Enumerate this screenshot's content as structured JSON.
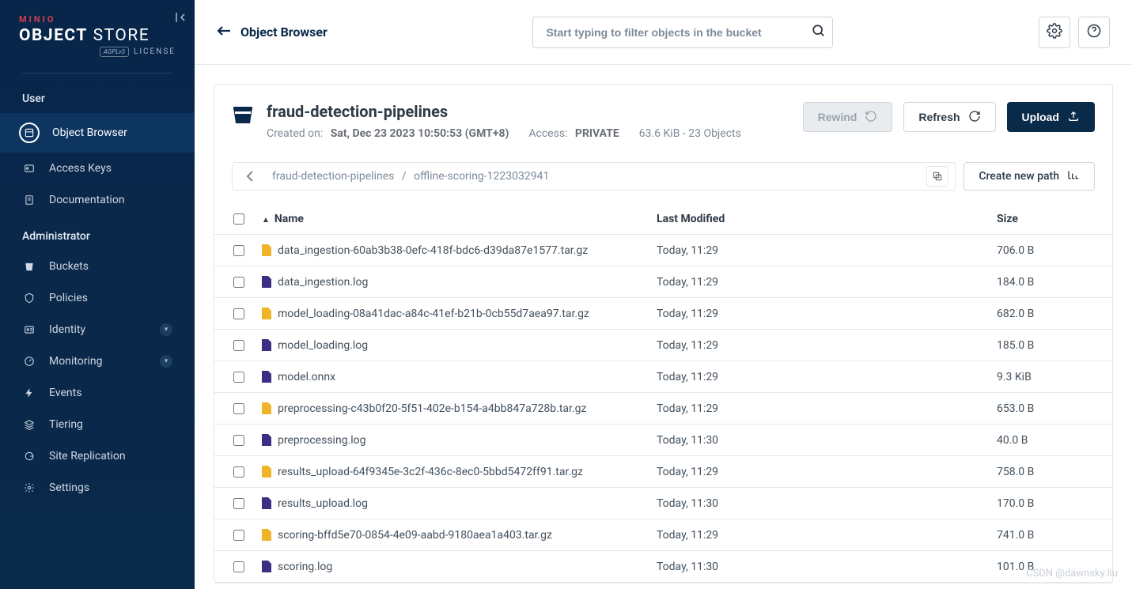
{
  "brand": {
    "minio": "MINIO",
    "object": "OBJECT",
    "store": "STORE",
    "license": "LICENSE",
    "agpl": "AGPLv3"
  },
  "sidebar": {
    "sections": [
      {
        "title": "User",
        "items": [
          {
            "label": "Object Browser",
            "icon": "layers"
          },
          {
            "label": "Access Keys",
            "icon": "key"
          },
          {
            "label": "Documentation",
            "icon": "doc"
          }
        ]
      },
      {
        "title": "Administrator",
        "items": [
          {
            "label": "Buckets",
            "icon": "bucket"
          },
          {
            "label": "Policies",
            "icon": "shield"
          },
          {
            "label": "Identity",
            "icon": "id",
            "expandable": true
          },
          {
            "label": "Monitoring",
            "icon": "gauge",
            "expandable": true
          },
          {
            "label": "Events",
            "icon": "bolt"
          },
          {
            "label": "Tiering",
            "icon": "layers3"
          },
          {
            "label": "Site Replication",
            "icon": "sync"
          },
          {
            "label": "Settings",
            "icon": "gear"
          }
        ]
      }
    ]
  },
  "header": {
    "title": "Object Browser",
    "searchPlaceholder": "Start typing to filter objects in the bucket"
  },
  "bucket": {
    "name": "fraud-detection-pipelines",
    "createdLabel": "Created on:",
    "created": "Sat, Dec 23 2023 10:50:53 (GMT+8)",
    "accessLabel": "Access:",
    "access": "PRIVATE",
    "stats": "63.6 KiB - 23 Objects",
    "rewind": "Rewind",
    "refresh": "Refresh",
    "upload": "Upload"
  },
  "breadcrumb": {
    "root": "fraud-detection-pipelines",
    "path": "offline-scoring-1223032941",
    "createPath": "Create new path"
  },
  "table": {
    "columns": {
      "name": "Name",
      "modified": "Last Modified",
      "size": "Size"
    },
    "rows": [
      {
        "name": "data_ingestion-60ab3b38-0efc-418f-bdc6-d39da87e1577.tar.gz",
        "type": "gz",
        "modified": "Today, 11:29",
        "size": "706.0 B"
      },
      {
        "name": "data_ingestion.log",
        "type": "log",
        "modified": "Today, 11:29",
        "size": "184.0 B"
      },
      {
        "name": "model_loading-08a41dac-a84c-41ef-b21b-0cb55d7aea97.tar.gz",
        "type": "gz",
        "modified": "Today, 11:29",
        "size": "682.0 B"
      },
      {
        "name": "model_loading.log",
        "type": "log",
        "modified": "Today, 11:29",
        "size": "185.0 B"
      },
      {
        "name": "model.onnx",
        "type": "log",
        "modified": "Today, 11:29",
        "size": "9.3 KiB"
      },
      {
        "name": "preprocessing-c43b0f20-5f51-402e-b154-a4bb847a728b.tar.gz",
        "type": "gz",
        "modified": "Today, 11:29",
        "size": "653.0 B"
      },
      {
        "name": "preprocessing.log",
        "type": "log",
        "modified": "Today, 11:30",
        "size": "40.0 B"
      },
      {
        "name": "results_upload-64f9345e-3c2f-436c-8ec0-5bbd5472ff91.tar.gz",
        "type": "gz",
        "modified": "Today, 11:29",
        "size": "758.0 B"
      },
      {
        "name": "results_upload.log",
        "type": "log",
        "modified": "Today, 11:30",
        "size": "170.0 B"
      },
      {
        "name": "scoring-bffd5e70-0854-4e09-aabd-9180aea1a403.tar.gz",
        "type": "gz",
        "modified": "Today, 11:29",
        "size": "741.0 B"
      },
      {
        "name": "scoring.log",
        "type": "log",
        "modified": "Today, 11:30",
        "size": "101.0 B"
      }
    ]
  },
  "watermark": "CSDN @dawnsky.liu"
}
